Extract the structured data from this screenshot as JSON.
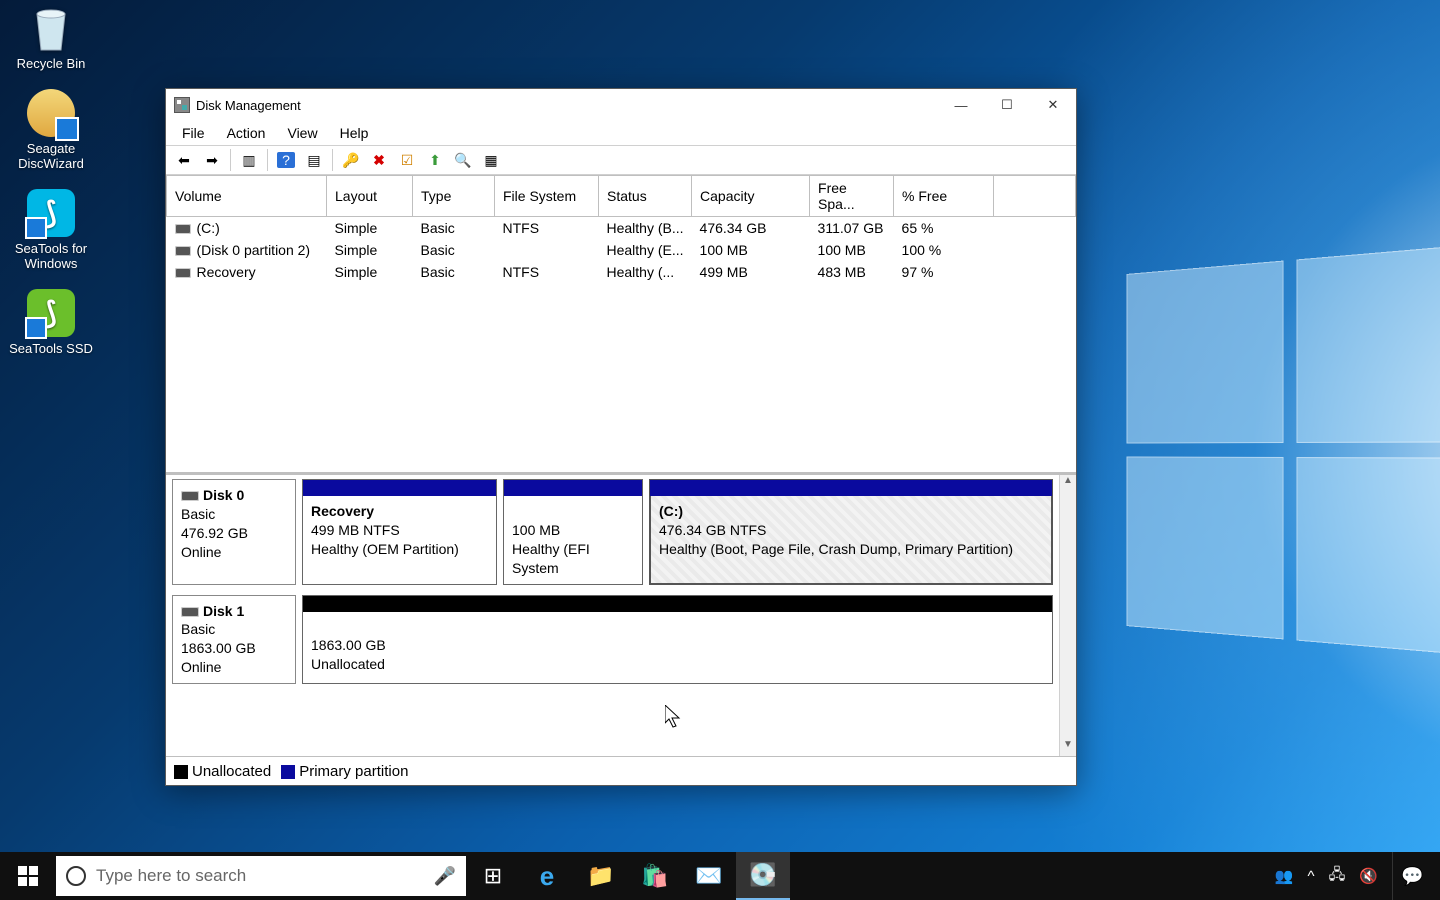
{
  "desktop_icons": {
    "recycle_bin": "Recycle Bin",
    "seagate_discwizard": "Seagate DiscWizard",
    "seatools_windows": "SeaTools for Windows",
    "seatools_ssd": "SeaTools SSD"
  },
  "window": {
    "title": "Disk Management",
    "menu": {
      "file": "File",
      "action": "Action",
      "view": "View",
      "help": "Help"
    }
  },
  "columns": {
    "volume": "Volume",
    "layout": "Layout",
    "type": "Type",
    "filesystem": "File System",
    "status": "Status",
    "capacity": "Capacity",
    "freespace": "Free Spa...",
    "pctfree": "% Free"
  },
  "volumes": [
    {
      "name": "(C:)",
      "layout": "Simple",
      "type": "Basic",
      "fs": "NTFS",
      "status": "Healthy (B...",
      "capacity": "476.34 GB",
      "free": "311.07 GB",
      "pct": "65 %"
    },
    {
      "name": "(Disk 0 partition 2)",
      "layout": "Simple",
      "type": "Basic",
      "fs": "",
      "status": "Healthy (E...",
      "capacity": "100 MB",
      "free": "100 MB",
      "pct": "100 %"
    },
    {
      "name": "Recovery",
      "layout": "Simple",
      "type": "Basic",
      "fs": "NTFS",
      "status": "Healthy (...",
      "capacity": "499 MB",
      "free": "483 MB",
      "pct": "97 %"
    }
  ],
  "disks": {
    "d0": {
      "label": "Disk 0",
      "type": "Basic",
      "size": "476.92 GB",
      "state": "Online",
      "recovery": {
        "title": "Recovery",
        "line2": "499 MB NTFS",
        "line3": "Healthy (OEM Partition)"
      },
      "efi": {
        "line2": "100 MB",
        "line3": "Healthy (EFI System"
      },
      "c": {
        "title": "(C:)",
        "line2": "476.34 GB NTFS",
        "line3": "Healthy (Boot, Page File, Crash Dump, Primary Partition)"
      }
    },
    "d1": {
      "label": "Disk 1",
      "type": "Basic",
      "size": "1863.00 GB",
      "state": "Online",
      "unalloc": {
        "line2": "1863.00 GB",
        "line3": "Unallocated"
      }
    }
  },
  "legend": {
    "unallocated": "Unallocated",
    "primary": "Primary partition"
  },
  "taskbar": {
    "search_placeholder": "Type here to search"
  }
}
